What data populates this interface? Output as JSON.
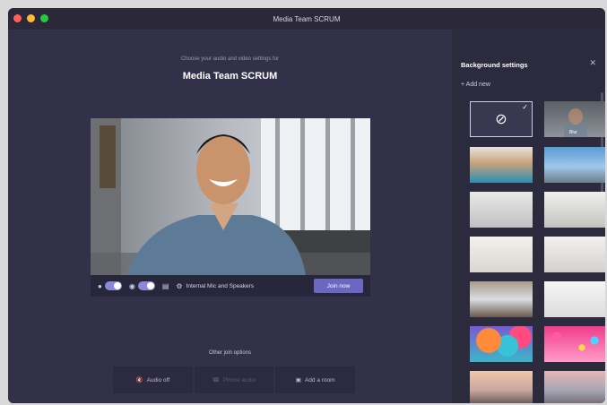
{
  "window": {
    "title": "Media Team SCRUM"
  },
  "prejoin": {
    "subtitle": "Choose your audio and video settings for",
    "meeting_name": "Media Team SCRUM",
    "audio_device": "Internal Mic and Speakers",
    "join_label": "Join now",
    "other_join_options": "Other join options",
    "options": [
      {
        "label": "Audio off",
        "icon": "speaker-off-icon"
      },
      {
        "label": "Phone audio",
        "icon": "phone-icon"
      },
      {
        "label": "Add a room",
        "icon": "room-icon"
      }
    ]
  },
  "background_settings": {
    "title": "Background settings",
    "add_new": "Add new",
    "thumb_small_label": "Blur",
    "selected_index": 0
  },
  "colors": {
    "accent": "#6c67c2",
    "toggle": "#8b88d6",
    "panel": "#2c2a3d",
    "main": "#33314a"
  }
}
